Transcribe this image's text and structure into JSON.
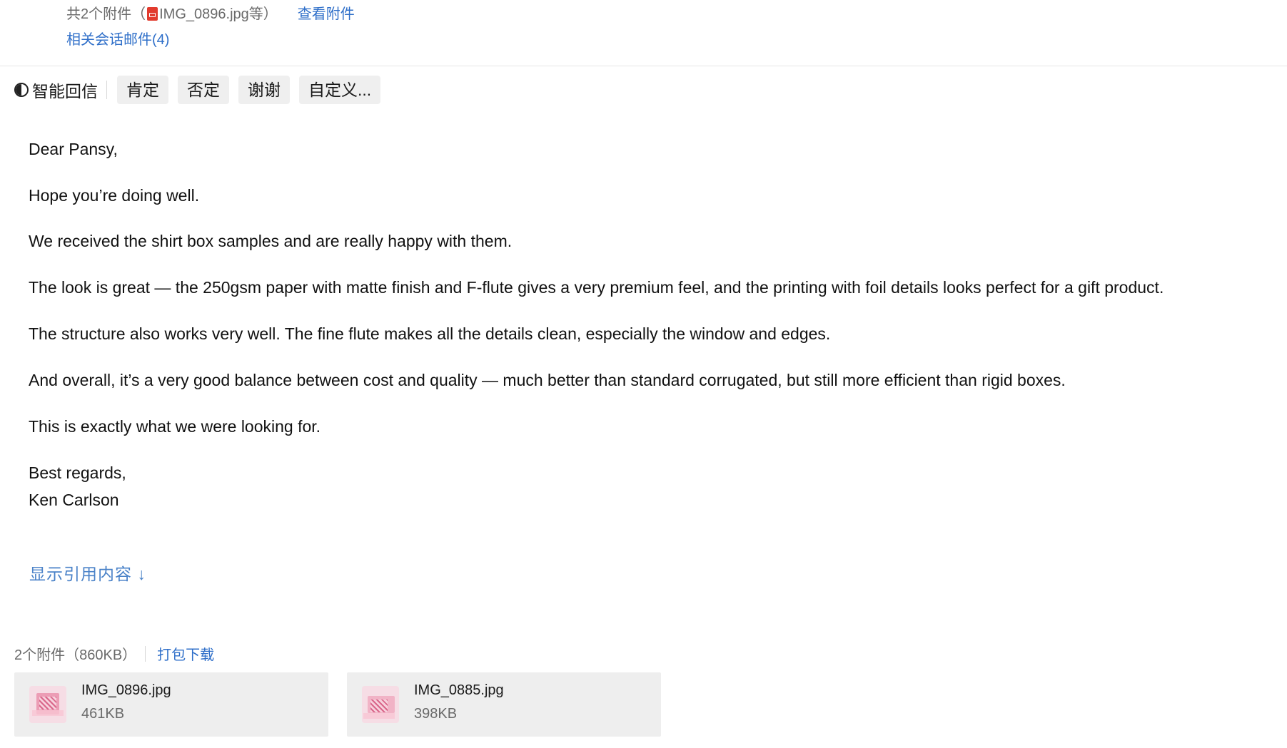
{
  "header": {
    "attachments_prefix": "共2个附件（",
    "attachments_file": "IMG_0896.jpg等",
    "attachments_suffix": "）",
    "view_attachments": "查看附件",
    "related_mails": "相关会话邮件(4)"
  },
  "smart_reply": {
    "label": "智能回信",
    "chips": [
      "肯定",
      "否定",
      "谢谢",
      "自定义..."
    ]
  },
  "body": {
    "greeting": "Dear Pansy,",
    "lines": [
      "Hope you’re doing well.",
      "We received the shirt box samples and are really happy with them.",
      "The look is great — the 250gsm paper with matte finish and F-flute gives a very premium feel, and the printing with foil details looks perfect for a gift product.",
      "The structure also works very well. The fine flute makes all the details clean, especially the window and edges.",
      "And overall, it’s a very good balance between cost and quality — much better than standard corrugated, but still more efficient than rigid boxes.",
      "This is exactly what we were looking for."
    ],
    "closing": "Best regards,",
    "signature": "Ken Carlson"
  },
  "show_quoted": "显示引用内容 ↓",
  "attachments": {
    "summary": "2个附件（860KB）",
    "download_all": "打包下载",
    "files": [
      {
        "name": "IMG_0896.jpg",
        "size": "461KB",
        "icon": "image-thumbnail-icon"
      },
      {
        "name": "IMG_0885.jpg",
        "size": "398KB",
        "icon": "image-thumbnail-icon"
      }
    ]
  },
  "colors": {
    "link": "#2f6fc9",
    "chip_bg": "#efefef",
    "card_bg": "#eeeeee",
    "pdf_icon": "#e23b2e"
  }
}
